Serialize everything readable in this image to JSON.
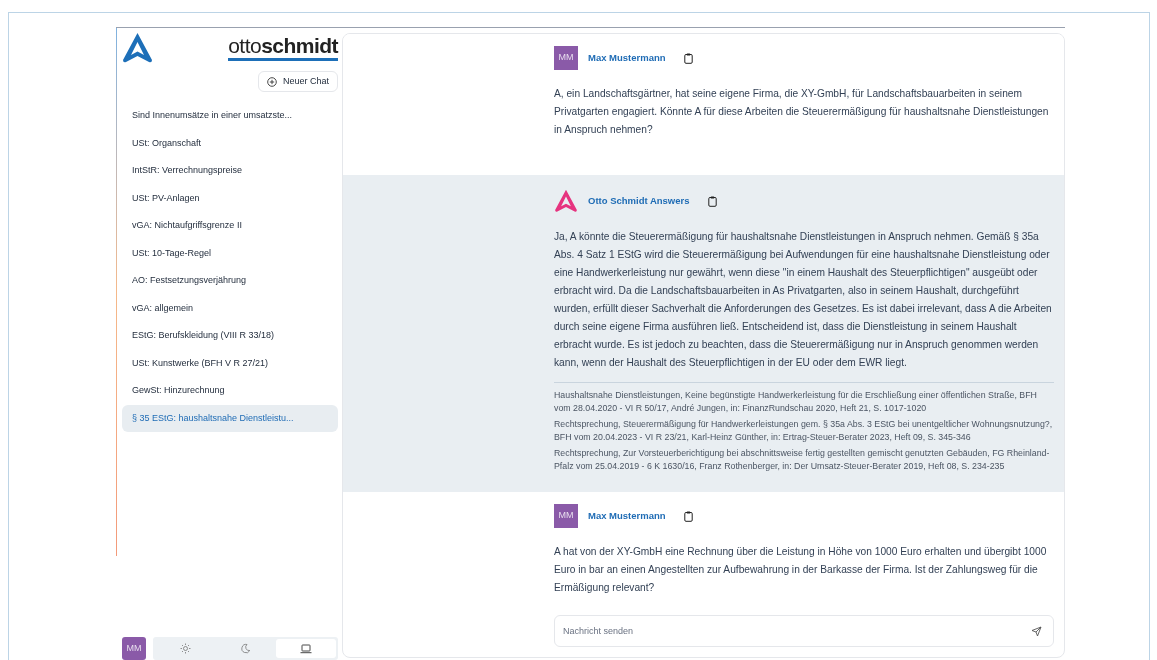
{
  "brand": {
    "wordmark": "otto**schmidt**"
  },
  "new_chat_button": {
    "label": "Neuer Chat"
  },
  "history": [
    {
      "label": "Sind Innenumsätze in einer umsatzste...",
      "selected": false
    },
    {
      "label": "USt: Organschaft",
      "selected": false
    },
    {
      "label": "IntStR: Verrechnungspreise",
      "selected": false
    },
    {
      "label": "USt: PV-Anlagen",
      "selected": false
    },
    {
      "label": "vGA: Nichtaufgriffsgrenze II",
      "selected": false
    },
    {
      "label": "USt: 10-Tage-Regel",
      "selected": false
    },
    {
      "label": "AO: Festsetzungsverjährung",
      "selected": false
    },
    {
      "label": "vGA: allgemein",
      "selected": false
    },
    {
      "label": "EStG: Berufskleidung (VIII R 33/18)",
      "selected": false
    },
    {
      "label": "USt: Kunstwerke (BFH V R 27/21)",
      "selected": false
    },
    {
      "label": "GewSt: Hinzurechnung",
      "selected": false
    },
    {
      "label": "§ 35 EStG: haushaltsnahe Dienstleistu...",
      "selected": true
    }
  ],
  "user": {
    "initials": "MM"
  },
  "theme_options": [
    {
      "kind": "light",
      "selected": false
    },
    {
      "kind": "dark",
      "selected": false
    },
    {
      "kind": "system",
      "selected": true
    }
  ],
  "messages": [
    {
      "kind": "user",
      "avatar": "MM",
      "author": "Max Mustermann",
      "text": "A, ein Landschaftsgärtner, hat seine eigene Firma, die XY-GmbH, für Landschaftsbauarbeiten in seinem Privatgarten engagiert. Könnte A für diese Arbeiten die Steuerermäßigung für haushaltsnahe Dienstleistungen in Anspruch nehmen?"
    },
    {
      "kind": "assistant",
      "author": "Otto Schmidt Answers",
      "text": "Ja, A könnte die Steuerermäßigung für haushaltsnahe Dienstleistungen in Anspruch nehmen. Gemäß § 35a Abs. 4 Satz 1 EStG wird die Steuerermäßigung bei Aufwendungen für eine haushaltsnahe Dienstleistung oder eine Handwerkerleistung nur gewährt, wenn diese \"in einem Haushalt des Steuerpflichtigen\" ausgeübt oder erbracht wird. Da die Landschaftsbauarbeiten in As Privatgarten, also in seinem Haushalt, durchgeführt wurden, erfüllt dieser Sachverhalt die Anforderungen des Gesetzes. Es ist dabei irrelevant, dass A die Arbeiten durch seine eigene Firma ausführen ließ. Entscheidend ist, dass die Dienstleistung in seinem Haushalt erbracht wurde. Es ist jedoch zu beachten, dass die Steuerermäßigung nur in Anspruch genommen werden kann, wenn der Haushalt des Steuerpflichtigen in der EU oder dem EWR liegt.",
      "sources": [
        "Haushaltsnahe Dienstleistungen, Keine begünstigte Handwerkerleistung für die Erschließung einer öffentlichen Straße, BFH vom 28.04.2020 - VI R 50/17, André Jungen, in: FinanzRundschau 2020, Heft 21, S. 1017-1020",
        "Rechtsprechung, Steuerermäßigung für Handwerkerleistungen gem. § 35a Abs. 3 EStG bei unentgeltlicher Wohnungsnutzung?, BFH vom 20.04.2023 - VI R 23/21, Karl-Heinz Günther, in: Ertrag-Steuer-Berater 2023, Heft 09, S. 345-346",
        "Rechtsprechung, Zur Vorsteuerberichtigung bei abschnittsweise fertig gestellten gemischt genutzten Gebäuden, FG Rheinland-Pfalz vom 25.04.2019 - 6 K 1630/16, Franz Rothenberger, in: Der Umsatz-Steuer-Berater 2019, Heft 08, S. 234-235"
      ]
    },
    {
      "kind": "user",
      "avatar": "MM",
      "author": "Max Mustermann",
      "text": "A hat von der XY-GmbH eine Rechnung über die Leistung in Höhe von 1000 Euro erhalten und übergibt 1000 Euro in bar an einen Angestellten zur Aufbewahrung in der Barkasse der Firma. Ist der Zahlungsweg für die Ermäßigung relevant?"
    }
  ],
  "composer": {
    "placeholder": "Nachricht senden"
  }
}
